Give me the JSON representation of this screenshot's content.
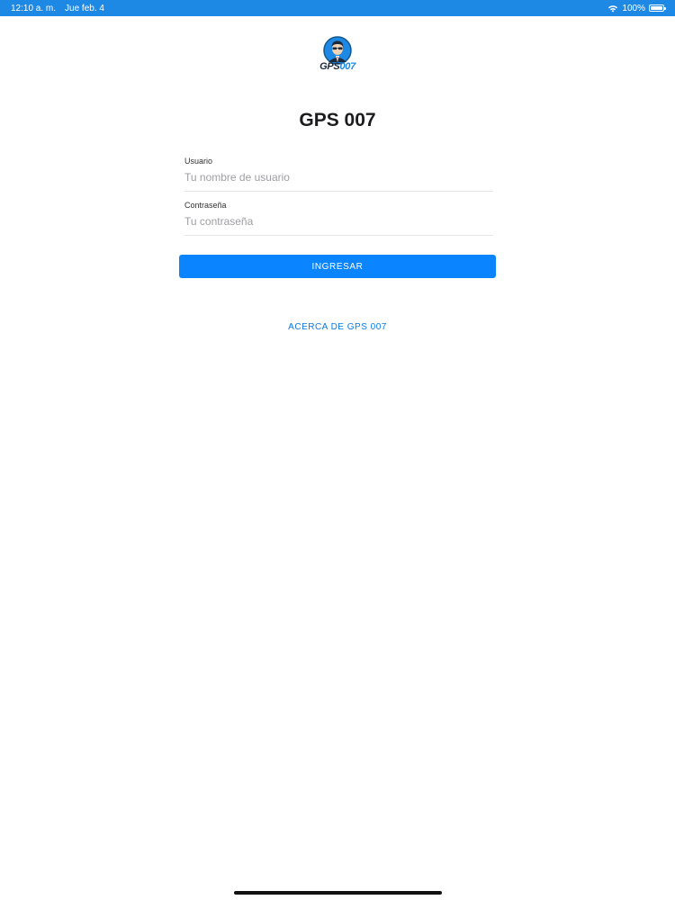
{
  "status_bar": {
    "time": "12:10 a. m.",
    "date": "Jue feb. 4",
    "battery_text": "100%",
    "battery_level": 1.0,
    "icons": [
      "wifi-icon",
      "battery-icon"
    ],
    "color": "#1e88e5"
  },
  "logo": {
    "wordmark_gps": "GPS",
    "wordmark_num": "007"
  },
  "title": "GPS 007",
  "form": {
    "username": {
      "label": "Usuario",
      "placeholder": "Tu nombre de usuario",
      "value": ""
    },
    "password": {
      "label": "Contraseña",
      "placeholder": "Tu contraseña",
      "value": ""
    }
  },
  "login_button": {
    "label": "INGRESAR",
    "color": "#0a84ff"
  },
  "about_link": {
    "label": "ACERCA DE GPS 007",
    "color": "#0a7be0"
  }
}
